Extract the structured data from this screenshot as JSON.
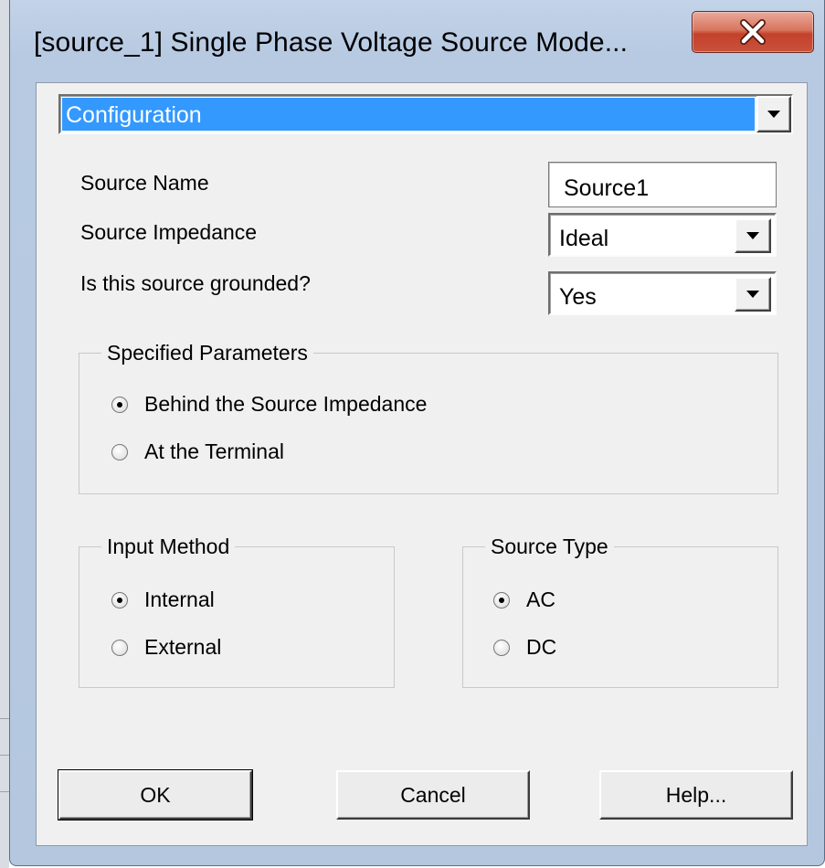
{
  "window": {
    "title": "[source_1] Single Phase Voltage Source Mode...",
    "close_glyph": "X"
  },
  "page_selector": {
    "value": "Configuration"
  },
  "fields": {
    "source_name": {
      "label": "Source Name",
      "value": "Source1"
    },
    "source_impedance": {
      "label": "Source Impedance",
      "value": "Ideal"
    },
    "grounded": {
      "label": "Is this source grounded?",
      "value": "Yes"
    }
  },
  "specified_parameters": {
    "title": "Specified Parameters",
    "options": [
      {
        "label": "Behind the Source Impedance",
        "selected": true
      },
      {
        "label": "At the Terminal",
        "selected": false
      }
    ]
  },
  "input_method": {
    "title": "Input Method",
    "options": [
      {
        "label": "Internal",
        "selected": true
      },
      {
        "label": "External",
        "selected": false
      }
    ]
  },
  "source_type": {
    "title": "Source Type",
    "options": [
      {
        "label": "AC",
        "selected": true
      },
      {
        "label": "DC",
        "selected": false
      }
    ]
  },
  "buttons": {
    "ok": "OK",
    "cancel": "Cancel",
    "help": "Help..."
  },
  "colors": {
    "selection": "#3399ff",
    "dialog_bg": "#f0f0f0",
    "close_button": "#c4412a"
  }
}
